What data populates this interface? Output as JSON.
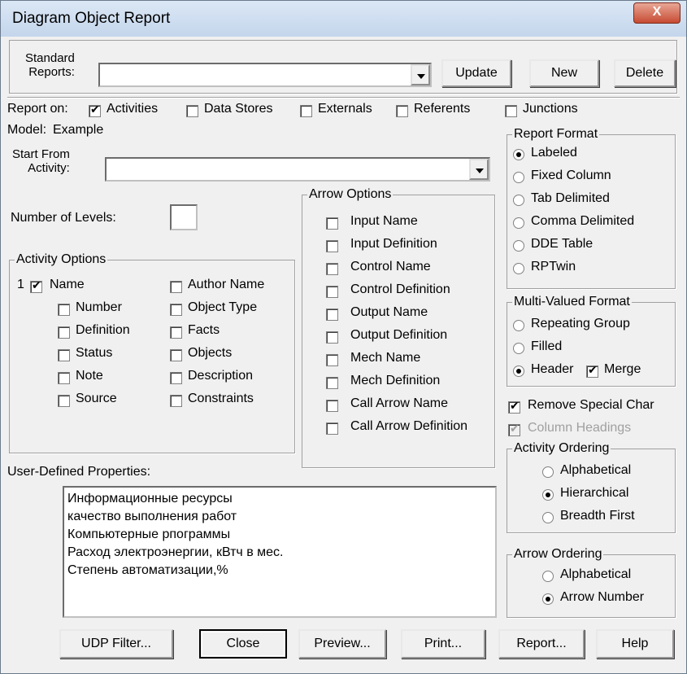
{
  "window": {
    "title": "Diagram Object Report",
    "close_glyph": "X"
  },
  "top": {
    "standard_reports_label_1": "Standard",
    "standard_reports_label_2": "Reports:",
    "standard_reports_value": "",
    "update": "Update",
    "new": "New",
    "delete": "Delete"
  },
  "report_on": {
    "label": "Report on:",
    "items": [
      {
        "label": "Activities",
        "checked": true
      },
      {
        "label": "Data Stores",
        "checked": false
      },
      {
        "label": "Externals",
        "checked": false
      },
      {
        "label": "Referents",
        "checked": false
      },
      {
        "label": "Junctions",
        "checked": false
      }
    ]
  },
  "model": {
    "label": "Model:",
    "value": "Example"
  },
  "start_from": {
    "label_1": "Start From",
    "label_2": "Activity:",
    "value": ""
  },
  "levels": {
    "label": "Number of Levels:",
    "value": ""
  },
  "activity_options": {
    "legend": "Activity Options",
    "order_prefix": "1",
    "left": [
      {
        "label": "Name",
        "checked": true
      },
      {
        "label": "Number",
        "checked": false
      },
      {
        "label": "Definition",
        "checked": false
      },
      {
        "label": "Status",
        "checked": false
      },
      {
        "label": "Note",
        "checked": false
      },
      {
        "label": "Source",
        "checked": false
      }
    ],
    "right": [
      {
        "label": "Author Name",
        "checked": false
      },
      {
        "label": "Object Type",
        "checked": false
      },
      {
        "label": "Facts",
        "checked": false
      },
      {
        "label": "Objects",
        "checked": false
      },
      {
        "label": "Description",
        "checked": false
      },
      {
        "label": "Constraints",
        "checked": false
      }
    ]
  },
  "arrow_options": {
    "legend": "Arrow Options",
    "items": [
      {
        "label": "Input Name",
        "checked": false
      },
      {
        "label": "Input Definition",
        "checked": false
      },
      {
        "label": "Control Name",
        "checked": false
      },
      {
        "label": "Control Definition",
        "checked": false
      },
      {
        "label": "Output Name",
        "checked": false
      },
      {
        "label": "Output Definition",
        "checked": false
      },
      {
        "label": "Mech Name",
        "checked": false
      },
      {
        "label": "Mech Definition",
        "checked": false
      },
      {
        "label": "Call Arrow Name",
        "checked": false
      },
      {
        "label": "Call Arrow Definition",
        "checked": false
      }
    ]
  },
  "report_format": {
    "legend": "Report Format",
    "items": [
      {
        "label": "Labeled",
        "selected": true
      },
      {
        "label": "Fixed Column",
        "selected": false
      },
      {
        "label": "Tab Delimited",
        "selected": false
      },
      {
        "label": "Comma Delimited",
        "selected": false
      },
      {
        "label": "DDE Table",
        "selected": false
      },
      {
        "label": "RPTwin",
        "selected": false
      }
    ]
  },
  "multi_valued": {
    "legend": "Multi-Valued Format",
    "repeating": "Repeating Group",
    "filled": "Filled",
    "header": "Header",
    "merge": "Merge",
    "merge_checked": true
  },
  "remove_special": {
    "label": "Remove Special Char",
    "checked": true
  },
  "column_headings": {
    "label": "Column Headings",
    "checked": true,
    "disabled": true
  },
  "activity_ordering": {
    "legend": "Activity Ordering",
    "items": [
      {
        "label": "Alphabetical",
        "selected": false
      },
      {
        "label": "Hierarchical",
        "selected": true
      },
      {
        "label": "Breadth First",
        "selected": false
      }
    ]
  },
  "arrow_ordering": {
    "legend": "Arrow Ordering",
    "items": [
      {
        "label": "Alphabetical",
        "selected": false
      },
      {
        "label": "Arrow Number",
        "selected": true
      }
    ]
  },
  "udp": {
    "label": "User-Defined Properties:",
    "lines": [
      "Информационные ресурсы",
      "качество выполнения работ",
      "Компьютерные рпограммы",
      "Расход электроэнергии, кВтч в мес.",
      "Степень автоматизации,%"
    ]
  },
  "buttons": {
    "udp_filter": "UDP Filter...",
    "close": "Close",
    "preview": "Preview...",
    "print": "Print...",
    "report": "Report...",
    "help": "Help"
  }
}
